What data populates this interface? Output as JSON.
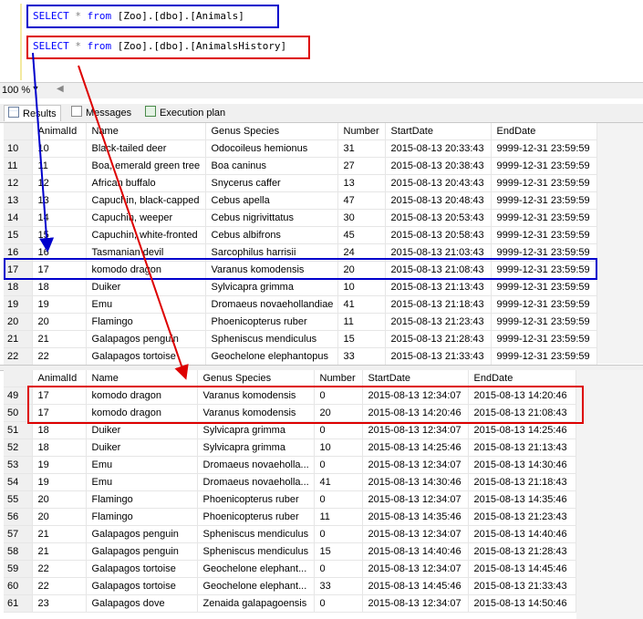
{
  "editor": {
    "query1": {
      "kw1": "SELECT",
      "star": " * ",
      "kw2": "from",
      "obj": " [Zoo].[dbo].[Animals]"
    },
    "query2": {
      "kw1": "SELECT",
      "star": " * ",
      "kw2": "from",
      "obj": " [Zoo].[dbo].[AnimalsHistory]"
    }
  },
  "zoom": {
    "value": "100 %",
    "dropdown_icon": "chevron-down-icon"
  },
  "tabs": [
    {
      "label": "Results",
      "icon": "grid-icon"
    },
    {
      "label": "Messages",
      "icon": "messages-icon"
    },
    {
      "label": "Execution plan",
      "icon": "execution-plan-icon"
    }
  ],
  "grid1": {
    "columns": [
      "AnimalId",
      "Name",
      "Genus Species",
      "Number",
      "StartDate",
      "EndDate"
    ],
    "rows": [
      [
        "10",
        "10",
        "Black-tailed deer",
        "Odocoileus hemionus",
        "31",
        "2015-08-13 20:33:43",
        "9999-12-31 23:59:59"
      ],
      [
        "11",
        "11",
        "Boa, emerald green tree",
        "Boa caninus",
        "27",
        "2015-08-13 20:38:43",
        "9999-12-31 23:59:59"
      ],
      [
        "12",
        "12",
        "African buffalo",
        "Snycerus caffer",
        "13",
        "2015-08-13 20:43:43",
        "9999-12-31 23:59:59"
      ],
      [
        "13",
        "13",
        "Capuchin, black-capped",
        "Cebus apella",
        "47",
        "2015-08-13 20:48:43",
        "9999-12-31 23:59:59"
      ],
      [
        "14",
        "14",
        "Capuchin, weeper",
        "Cebus nigrivittatus",
        "30",
        "2015-08-13 20:53:43",
        "9999-12-31 23:59:59"
      ],
      [
        "15",
        "15",
        "Capuchin, white-fronted",
        "Cebus albifrons",
        "45",
        "2015-08-13 20:58:43",
        "9999-12-31 23:59:59"
      ],
      [
        "16",
        "16",
        "Tasmanian devil",
        "Sarcophilus harrisii",
        "24",
        "2015-08-13 21:03:43",
        "9999-12-31 23:59:59"
      ],
      [
        "17",
        "17",
        "komodo dragon",
        "Varanus komodensis",
        "20",
        "2015-08-13 21:08:43",
        "9999-12-31 23:59:59"
      ],
      [
        "18",
        "18",
        "Duiker",
        "Sylvicapra grimma",
        "10",
        "2015-08-13 21:13:43",
        "9999-12-31 23:59:59"
      ],
      [
        "19",
        "19",
        "Emu",
        "Dromaeus novaehollandiae",
        "41",
        "2015-08-13 21:18:43",
        "9999-12-31 23:59:59"
      ],
      [
        "20",
        "20",
        "Flamingo",
        "Phoenicopterus ruber",
        "11",
        "2015-08-13 21:23:43",
        "9999-12-31 23:59:59"
      ],
      [
        "21",
        "21",
        "Galapagos penguin",
        "Spheniscus mendiculus",
        "15",
        "2015-08-13 21:28:43",
        "9999-12-31 23:59:59"
      ],
      [
        "22",
        "22",
        "Galapagos tortoise",
        "Geochelone elephantopus",
        "33",
        "2015-08-13 21:33:43",
        "9999-12-31 23:59:59"
      ]
    ]
  },
  "grid2": {
    "columns": [
      "AnimalId",
      "Name",
      "Genus Species",
      "Number",
      "StartDate",
      "EndDate"
    ],
    "rows": [
      [
        "49",
        "17",
        "komodo dragon",
        "Varanus komodensis",
        "0",
        "2015-08-13 12:34:07",
        "2015-08-13 14:20:46"
      ],
      [
        "50",
        "17",
        "komodo dragon",
        "Varanus komodensis",
        "20",
        "2015-08-13 14:20:46",
        "2015-08-13 21:08:43"
      ],
      [
        "51",
        "18",
        "Duiker",
        "Sylvicapra grimma",
        "0",
        "2015-08-13 12:34:07",
        "2015-08-13 14:25:46"
      ],
      [
        "52",
        "18",
        "Duiker",
        "Sylvicapra grimma",
        "10",
        "2015-08-13 14:25:46",
        "2015-08-13 21:13:43"
      ],
      [
        "53",
        "19",
        "Emu",
        "Dromaeus novaeholla...",
        "0",
        "2015-08-13 12:34:07",
        "2015-08-13 14:30:46"
      ],
      [
        "54",
        "19",
        "Emu",
        "Dromaeus novaeholla...",
        "41",
        "2015-08-13 14:30:46",
        "2015-08-13 21:18:43"
      ],
      [
        "55",
        "20",
        "Flamingo",
        "Phoenicopterus ruber",
        "0",
        "2015-08-13 12:34:07",
        "2015-08-13 14:35:46"
      ],
      [
        "56",
        "20",
        "Flamingo",
        "Phoenicopterus ruber",
        "11",
        "2015-08-13 14:35:46",
        "2015-08-13 21:23:43"
      ],
      [
        "57",
        "21",
        "Galapagos penguin",
        "Spheniscus mendiculus",
        "0",
        "2015-08-13 12:34:07",
        "2015-08-13 14:40:46"
      ],
      [
        "58",
        "21",
        "Galapagos penguin",
        "Spheniscus mendiculus",
        "15",
        "2015-08-13 14:40:46",
        "2015-08-13 21:28:43"
      ],
      [
        "59",
        "22",
        "Galapagos tortoise",
        "Geochelone elephant...",
        "0",
        "2015-08-13 12:34:07",
        "2015-08-13 14:45:46"
      ],
      [
        "60",
        "22",
        "Galapagos tortoise",
        "Geochelone elephant...",
        "33",
        "2015-08-13 14:45:46",
        "2015-08-13 21:33:43"
      ],
      [
        "61",
        "23",
        "Galapagos dove",
        "Zenaida galapagoensis",
        "0",
        "2015-08-13 12:34:07",
        "2015-08-13 14:50:46"
      ]
    ]
  },
  "colors": {
    "blue_highlight": "#0000cc",
    "red_highlight": "#dd0000",
    "sql_keyword": "#0000ff"
  }
}
